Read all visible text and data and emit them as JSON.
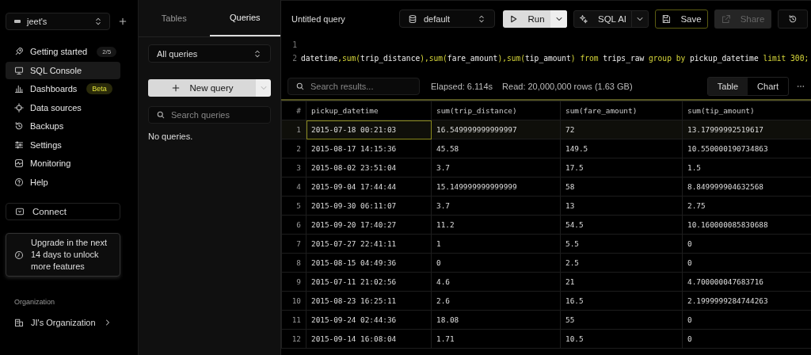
{
  "workspace": {
    "name": "jeet's"
  },
  "nav": [
    {
      "label": "Getting started",
      "badge": {
        "text": "2/5",
        "kind": "count"
      },
      "selected": false
    },
    {
      "label": "SQL Console",
      "selected": true
    },
    {
      "label": "Dashboards",
      "badge": {
        "text": "Beta",
        "kind": "beta"
      },
      "selected": false
    },
    {
      "label": "Data sources",
      "selected": false
    },
    {
      "label": "Backups",
      "selected": false
    },
    {
      "label": "Settings",
      "selected": false
    },
    {
      "label": "Monitoring",
      "selected": false
    },
    {
      "label": "Help",
      "selected": false
    }
  ],
  "connect": {
    "label": "Connect"
  },
  "upgrade": {
    "text": "Upgrade in the next 14 days to unlock more features"
  },
  "organization": {
    "heading": "Organization",
    "name": "JI's Organization"
  },
  "queries_panel": {
    "tabs": [
      {
        "label": "Tables",
        "selected": false
      },
      {
        "label": "Queries",
        "selected": true
      }
    ],
    "filter": "All queries",
    "new_button": "New query",
    "search": {
      "placeholder": "Search queries"
    },
    "empty_text": "No queries."
  },
  "editor": {
    "title": "Untitled query",
    "database": "default",
    "run": "Run",
    "ai": "SQL AI",
    "save": "Save",
    "share": {
      "label": "Share",
      "disabled": true
    },
    "lines": [
      {
        "number": "1"
      },
      {
        "number": "2",
        "tokens": [
          {
            "text": "datetime",
            "kind": "ident"
          },
          {
            "text": ",sum(",
            "kind": "keyword"
          },
          {
            "text": "trip_distance",
            "kind": "ident"
          },
          {
            "text": "),sum(",
            "kind": "keyword"
          },
          {
            "text": "fare_amount",
            "kind": "ident"
          },
          {
            "text": "),sum(",
            "kind": "keyword"
          },
          {
            "text": "tip_amount",
            "kind": "ident"
          },
          {
            "text": ") from ",
            "kind": "keyword"
          },
          {
            "text": "trips_raw",
            "kind": "ident"
          },
          {
            "text": " group by ",
            "kind": "keyword"
          },
          {
            "text": "pickup_datetime",
            "kind": "ident"
          },
          {
            "text": " limit 300;",
            "kind": "keyword"
          }
        ]
      }
    ]
  },
  "results": {
    "search": {
      "placeholder": "Search results..."
    },
    "elapsed": "Elapsed: 6.114s",
    "read": "Read: 20,000,000 rows (1.63 GB)",
    "views": [
      {
        "label": "Table",
        "selected": true
      },
      {
        "label": "Chart",
        "selected": false
      }
    ],
    "table": {
      "columns": [
        "#",
        "pickup_datetime",
        "sum(trip_distance)",
        "sum(fare_amount)",
        "sum(tip_amount)"
      ],
      "rows": [
        {
          "cells": [
            "1",
            "2015-07-18 00:21:03",
            "16.549999999999997",
            "72",
            "13.17999992519617"
          ],
          "selected": true
        },
        {
          "cells": [
            "2",
            "2015-08-17 14:15:36",
            "45.58",
            "149.5",
            "10.550000190734863"
          ],
          "selected": false
        },
        {
          "cells": [
            "3",
            "2015-08-02 23:51:04",
            "3.7",
            "17.5",
            "1.5"
          ],
          "selected": false
        },
        {
          "cells": [
            "4",
            "2015-09-04 17:44:44",
            "15.149999999999999",
            "58",
            "8.849999904632568"
          ],
          "selected": false
        },
        {
          "cells": [
            "5",
            "2015-09-30 06:11:07",
            "3.7",
            "13",
            "2.75"
          ],
          "selected": false
        },
        {
          "cells": [
            "6",
            "2015-09-20 17:40:27",
            "11.2",
            "54.5",
            "10.160000085830688"
          ],
          "selected": false
        },
        {
          "cells": [
            "7",
            "2015-07-27 22:41:11",
            "1",
            "5.5",
            "0"
          ],
          "selected": false
        },
        {
          "cells": [
            "8",
            "2015-08-15 04:49:36",
            "0",
            "2.5",
            "0"
          ],
          "selected": false
        },
        {
          "cells": [
            "9",
            "2015-07-11 21:02:56",
            "4.6",
            "21",
            "4.700000047683716"
          ],
          "selected": false
        },
        {
          "cells": [
            "10",
            "2015-08-23 16:25:11",
            "2.6",
            "16.5",
            "2.1999999284744263"
          ],
          "selected": false
        },
        {
          "cells": [
            "11",
            "2015-09-24 02:44:36",
            "18.08",
            "55",
            "0"
          ],
          "selected": false
        },
        {
          "cells": [
            "12",
            "2015-09-14 16:08:04",
            "1.71",
            "10.5",
            "0"
          ],
          "selected": false
        }
      ]
    }
  }
}
